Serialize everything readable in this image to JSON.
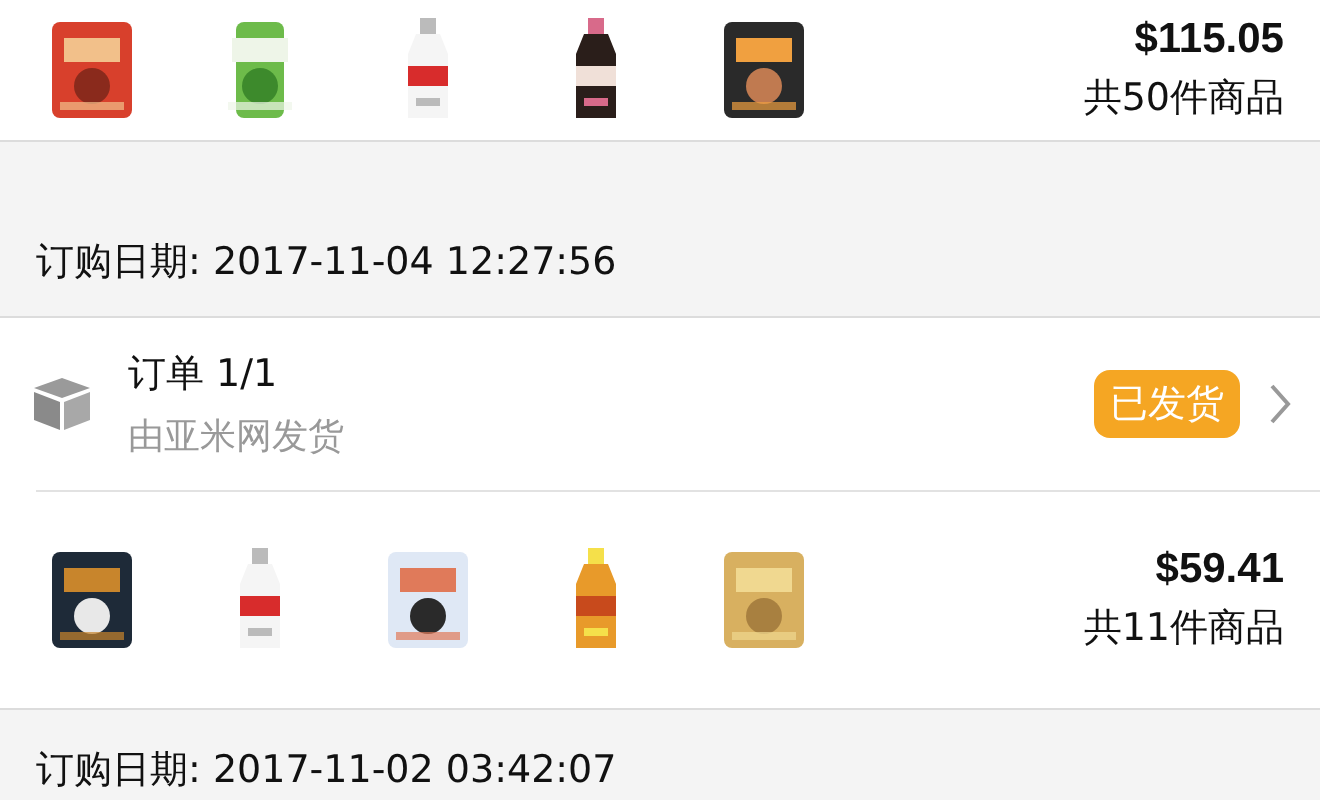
{
  "top_order": {
    "total": "$115.05",
    "count": "共50件商品"
  },
  "sections": [
    {
      "date_label": "订购日期: 2017-11-04 12:27:56",
      "order": {
        "title": "订单 1/1",
        "shipper": "由亚米网发货",
        "status": "已发货",
        "total": "$59.41",
        "count": "共11件商品"
      }
    }
  ],
  "next_date_label": "订购日期: 2017-11-02 03:42:07"
}
